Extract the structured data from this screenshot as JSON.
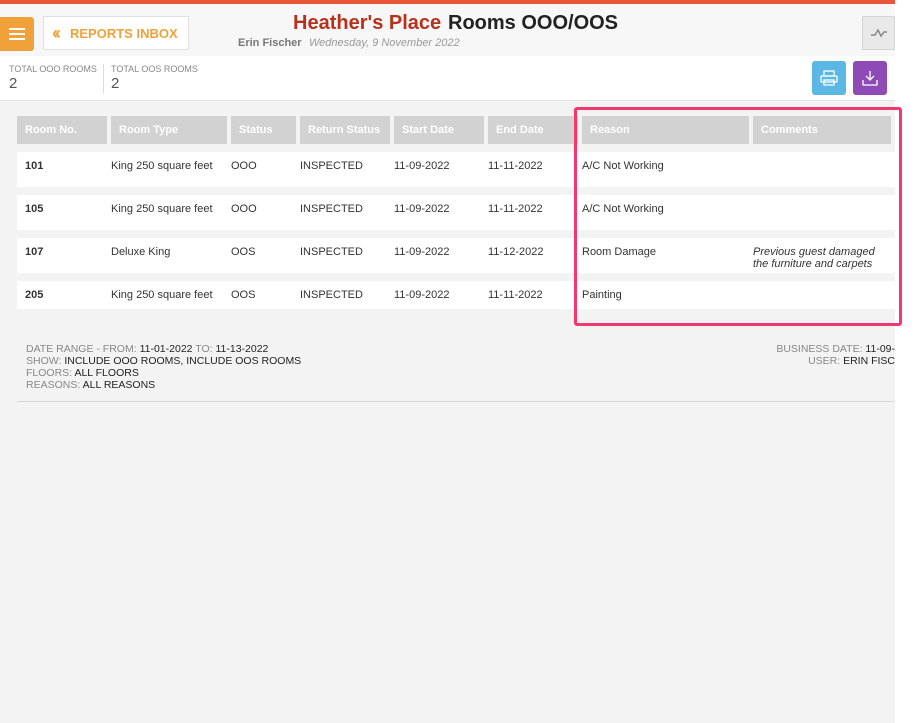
{
  "header": {
    "back_label": "REPORTS INBOX",
    "hotel_name": "Heather's Place",
    "page_title": "Rooms OOO/OOS",
    "user_name": "Erin Fischer",
    "date": "Wednesday, 9 November 2022"
  },
  "stats": [
    {
      "label": "TOTAL OOO ROOMS",
      "value": "2"
    },
    {
      "label": "TOTAL OOS ROOMS",
      "value": "2"
    }
  ],
  "table": {
    "columns": [
      "Room No.",
      "Room Type",
      "Status",
      "Return Status",
      "Start Date",
      "End Date",
      "Reason",
      "Comments"
    ],
    "rows": [
      {
        "room": "101",
        "type": "King 250 square feet",
        "status": "OOO",
        "return_status": "INSPECTED",
        "start": "11-09-2022",
        "end": "11-11-2022",
        "reason": "A/C Not Working",
        "comments": ""
      },
      {
        "room": "105",
        "type": "King 250 square feet",
        "status": "OOO",
        "return_status": "INSPECTED",
        "start": "11-09-2022",
        "end": "11-11-2022",
        "reason": "A/C Not Working",
        "comments": ""
      },
      {
        "room": "107",
        "type": "Deluxe King",
        "status": "OOS",
        "return_status": "INSPECTED",
        "start": "11-09-2022",
        "end": "11-12-2022",
        "reason": "Room Damage",
        "comments": "Previous guest damaged the furniture and carpets"
      },
      {
        "room": "205",
        "type": "King 250 square feet",
        "status": "OOS",
        "return_status": "INSPECTED",
        "start": "11-09-2022",
        "end": "11-11-2022",
        "reason": "Painting",
        "comments": ""
      }
    ]
  },
  "filters": {
    "date_range_label": "DATE RANGE - FROM:",
    "date_from": "11-01-2022",
    "to_label": "TO:",
    "date_to": "11-13-2022",
    "show_label": "SHOW:",
    "show_value": "INCLUDE OOO ROOMS, INCLUDE OOS ROOMS",
    "floors_label": "FLOORS:",
    "floors_value": "ALL FLOORS",
    "reasons_label": "REASONS:",
    "reasons_value": "ALL REASONS"
  },
  "footer": {
    "business_date_label": "BUSINESS DATE:",
    "business_date_value": "11-09-",
    "user_label": "USER:",
    "user_value": "ERIN FISC"
  },
  "colors": {
    "accent_orange": "#f0a13a",
    "hotel_red": "#b7321c",
    "print_blue": "#5bb7e4",
    "download_purple": "#8e4bb5",
    "highlight_pink": "#f2386e"
  },
  "icons": [
    "menu-icon",
    "double-chevron-left-icon",
    "activity-icon",
    "printer-icon",
    "download-icon"
  ]
}
